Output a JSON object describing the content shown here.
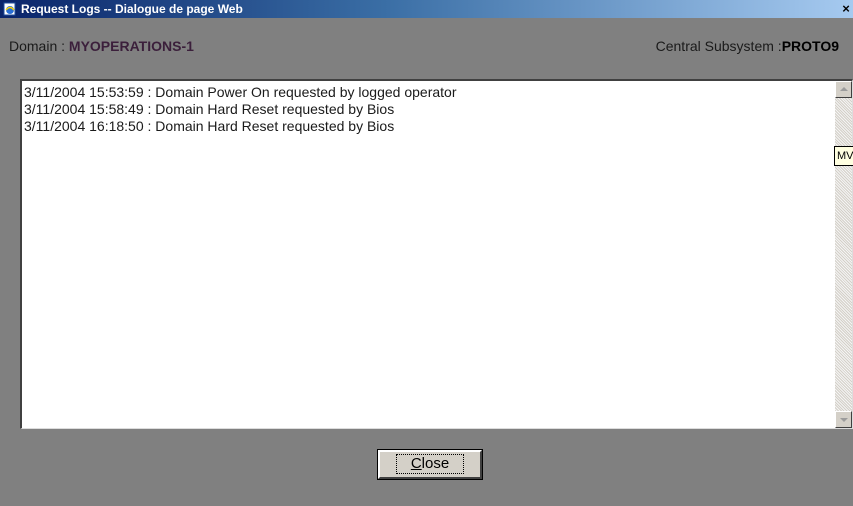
{
  "window": {
    "title": "Request Logs -- Dialogue de page Web",
    "close_symbol": "×"
  },
  "header": {
    "domain_label": "Domain : ",
    "domain_value": "MYOPERATIONS-1",
    "subsystem_label": "Central Subsystem :",
    "subsystem_value": "PROTO9"
  },
  "logs": [
    "3/11/2004 15:53:59 : Domain Power On requested by logged operator",
    "3/11/2004 15:58:49 : Domain Hard Reset requested by Bios",
    "3/11/2004 16:18:50 : Domain Hard Reset requested by Bios"
  ],
  "tooltip": {
    "text": "MV"
  },
  "buttons": {
    "close_first_letter": "C",
    "close_rest": "lose"
  },
  "colors": {
    "titlebar_start": "#0a246a",
    "titlebar_end": "#a6caf0",
    "client_background": "#808080",
    "domain_value": "#3b1f3b"
  },
  "icons": {
    "title": "ie-page-icon"
  }
}
